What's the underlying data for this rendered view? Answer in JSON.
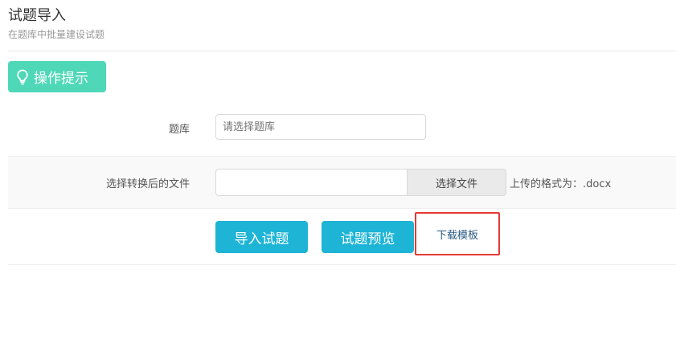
{
  "header": {
    "title": "试题导入",
    "subtitle": "在题库中批量建设试题"
  },
  "tips_button": {
    "icon": "lightbulb-icon",
    "label": "操作提示"
  },
  "form": {
    "bank_label": "题库",
    "bank_placeholder": "请选择题库",
    "file_label": "选择转换后的文件",
    "file_value": "",
    "choose_file_label": "选择文件",
    "format_hint": "上传的格式为：.docx"
  },
  "actions": {
    "import_label": "导入试题",
    "preview_label": "试题预览",
    "download_label": "下载模板"
  },
  "colors": {
    "tips_bg": "#4fd8b8",
    "primary_button": "#1db4d6",
    "highlight_border": "#e53935",
    "link": "#2a5a86"
  }
}
